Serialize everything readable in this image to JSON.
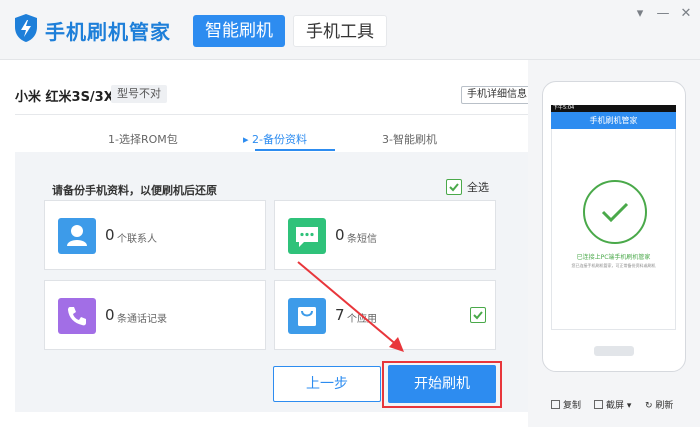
{
  "app": {
    "title": "手机刷机管家"
  },
  "nav": {
    "tabs": [
      {
        "label": "智能刷机",
        "active": true
      },
      {
        "label": "手机工具",
        "active": false
      }
    ]
  },
  "window_controls": {
    "menu": "▾",
    "minimize": "—",
    "close": "✕"
  },
  "device": {
    "name": "小米  红米3S/3X",
    "model_badge": "型号不对",
    "detail_button": "手机详细信息"
  },
  "steps": [
    {
      "label": "1-选择ROM包"
    },
    {
      "label": "▸ 2-备份资料",
      "active": true
    },
    {
      "label": "3-智能刷机"
    }
  ],
  "backup": {
    "title": "请备份手机资料，以便刷机后还原",
    "select_all": {
      "label": "全选",
      "checked": true
    },
    "items": [
      {
        "count": "0",
        "label": "个联系人",
        "icon": "contact-icon",
        "color": "#3d9be9"
      },
      {
        "count": "0",
        "label": "条短信",
        "icon": "sms-icon",
        "color": "#2fc27a"
      },
      {
        "count": "0",
        "label": "条通话记录",
        "icon": "phone-icon",
        "color": "#a26ee6"
      },
      {
        "count": "7",
        "label": "个应用",
        "icon": "app-bag-icon",
        "color": "#3d9be9",
        "checked": true
      }
    ]
  },
  "buttons": {
    "prev": "上一步",
    "start": "开始刷机"
  },
  "phone": {
    "status_time": "下午5:04",
    "header": "手机刷机管家",
    "status_message": "已连接上PC端手机刷机管家",
    "status_sub": "您已连接手机刷机管家，可正常备份资料或刷机"
  },
  "toolbar": {
    "copy": "复制",
    "screenshot": "截屏",
    "refresh": "刷新"
  },
  "colors": {
    "accent": "#2d8cf0",
    "success": "#4aa94a",
    "highlight": "#e8363b"
  }
}
